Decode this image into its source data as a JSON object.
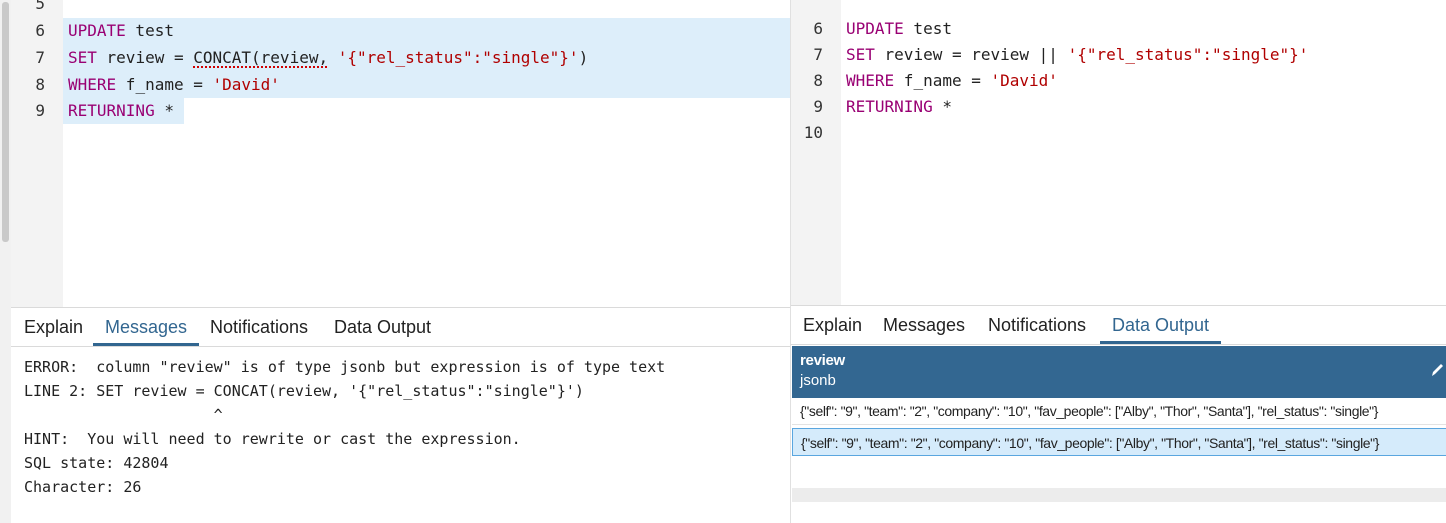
{
  "left": {
    "top_line_number": "5",
    "editor_lines": [
      {
        "n": "6",
        "kw": "UPDATE",
        "rest": " test"
      },
      {
        "n": "7",
        "kw": "SET",
        "pre": " review = ",
        "fn": "CONCAT(review,",
        "mid": " ",
        "str": "'{\"rel_status\":\"single\"}'",
        "post": ")"
      },
      {
        "n": "8",
        "kw": "WHERE",
        "pre": " f_name = ",
        "str": "'David'"
      },
      {
        "n": "9",
        "kw": "RETURNING",
        "rest": " *"
      }
    ],
    "tabs": [
      "Explain",
      "Messages",
      "Notifications",
      "Data Output"
    ],
    "active_tab": "Messages",
    "messages": [
      "ERROR:  column \"review\" is of type jsonb but expression is of type text",
      "LINE 2: SET review = CONCAT(review, '{\"rel_status\":\"single\"}')",
      "                     ^",
      "HINT:  You will need to rewrite or cast the expression.",
      "SQL state: 42804",
      "Character: 26"
    ]
  },
  "right": {
    "editor_lines": [
      {
        "n": "6",
        "kw": "UPDATE",
        "rest": " test"
      },
      {
        "n": "7",
        "kw": "SET",
        "pre": " review = review || ",
        "str": "'{\"rel_status\":\"single\"}'"
      },
      {
        "n": "8",
        "kw": "WHERE",
        "pre": " f_name = ",
        "str": "'David'"
      },
      {
        "n": "9",
        "kw": "RETURNING",
        "rest": " *"
      },
      {
        "n": "10"
      }
    ],
    "tabs": [
      "Explain",
      "Messages",
      "Notifications",
      "Data Output"
    ],
    "active_tab": "Data Output",
    "grid": {
      "column_name": "review",
      "column_type": "jsonb",
      "rows": [
        "{\"self\": \"9\", \"team\": \"2\", \"company\": \"10\", \"fav_people\": [\"Alby\", \"Thor\", \"Santa\"], \"rel_status\": \"single\"}",
        "{\"self\": \"9\", \"team\": \"2\", \"company\": \"10\", \"fav_people\": [\"Alby\", \"Thor\", \"Santa\"], \"rel_status\": \"single\"}"
      ]
    }
  },
  "colors": {
    "keyword": "#990073",
    "string": "#b00000",
    "accent": "#326690",
    "grid_header": "#336791",
    "selection": "#ddeefa"
  }
}
